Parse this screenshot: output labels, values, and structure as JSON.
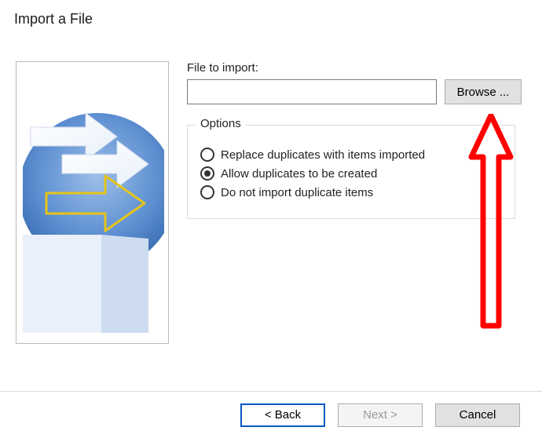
{
  "title": "Import a File",
  "fileToImportLabel": "File to import:",
  "filePath": "",
  "filePathPlaceholder": "",
  "browseLabel": "Browse ...",
  "options": {
    "legend": "Options",
    "items": [
      {
        "id": "replace",
        "label": "Replace duplicates with items imported",
        "selected": false
      },
      {
        "id": "allow",
        "label": "Allow duplicates to be created",
        "selected": true
      },
      {
        "id": "skip",
        "label": "Do not import duplicate items",
        "selected": false
      }
    ]
  },
  "buttons": {
    "back": "<  Back",
    "next": "Next  >",
    "cancel": "Cancel"
  },
  "callout_arrow_color": "#ff0000"
}
